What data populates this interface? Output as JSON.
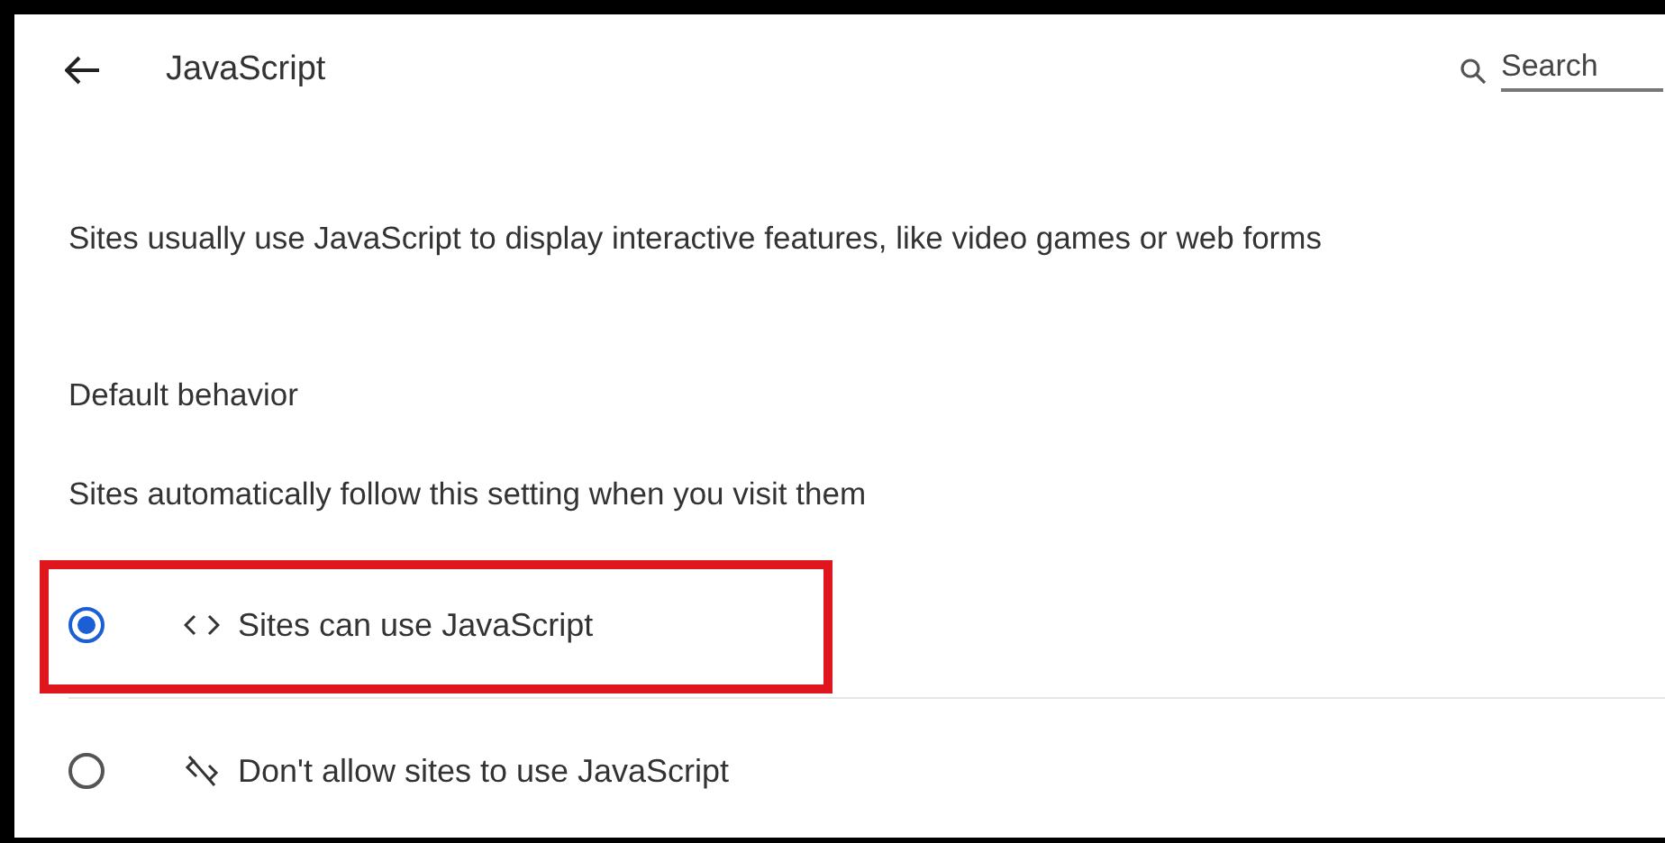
{
  "header": {
    "title": "JavaScript"
  },
  "search": {
    "placeholder": "Search"
  },
  "description": "Sites usually use JavaScript to display interactive features, like video games or web forms",
  "section": {
    "title": "Default behavior",
    "subtitle": "Sites automatically follow this setting when you visit them"
  },
  "options": [
    {
      "label": "Sites can use JavaScript",
      "kind": "allow",
      "selected": true,
      "highlighted": true
    },
    {
      "label": "Don't allow sites to use JavaScript",
      "kind": "block",
      "selected": false,
      "highlighted": false
    }
  ]
}
